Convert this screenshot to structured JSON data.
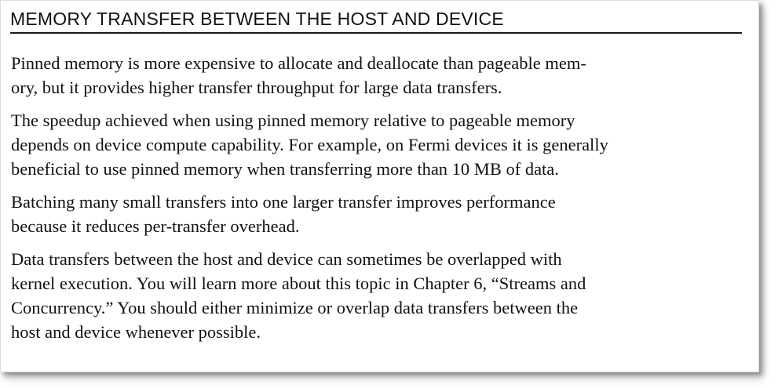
{
  "box": {
    "title": "MEMORY TRANSFER BETWEEN THE HOST AND DEVICE",
    "paragraphs": [
      {
        "lines": [
          "Pinned memory is more expensive to allocate and deallocate than pageable mem-",
          "ory, but it provides higher transfer throughput for large data transfers."
        ]
      },
      {
        "lines": [
          "The speedup achieved when using pinned memory relative to pageable memory",
          "depends on device compute capability. For example, on Fermi devices it is generally",
          "beneficial to use pinned memory when transferring more than 10 MB of data."
        ]
      },
      {
        "lines": [
          "Batching many small transfers into one larger transfer improves performance",
          "because it reduces per-transfer overhead."
        ]
      },
      {
        "lines": [
          "Data transfers between the host and device can sometimes be overlapped with",
          "kernel execution. You will learn more about this topic in Chapter 6, “Streams and",
          "Concurrency.” You should either minimize or overlap data transfers between the",
          "host and device whenever possible."
        ]
      }
    ]
  }
}
